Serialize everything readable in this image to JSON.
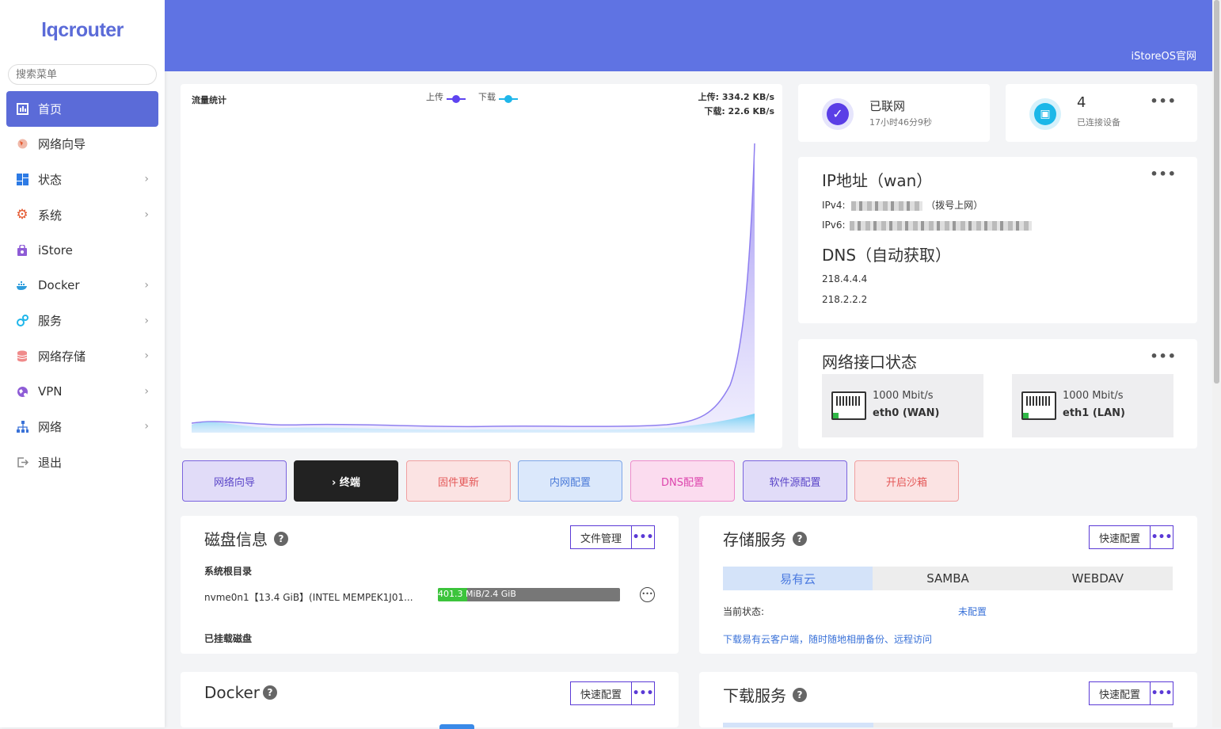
{
  "sidebar": {
    "logo": "lqcrouter",
    "search_placeholder": "搜索菜单",
    "items": [
      {
        "label": "首页",
        "icon": "dashboard-icon",
        "active": true
      },
      {
        "label": "网络向导",
        "icon": "globe-icon"
      },
      {
        "label": "状态",
        "icon": "grid-icon",
        "arrow": true
      },
      {
        "label": "系统",
        "icon": "gear-icon",
        "arrow": true
      },
      {
        "label": "iStore",
        "icon": "store-bag-icon"
      },
      {
        "label": "Docker",
        "icon": "docker-icon",
        "arrow": true
      },
      {
        "label": "服务",
        "icon": "services-icon",
        "arrow": true
      },
      {
        "label": "网络存储",
        "icon": "database-icon",
        "arrow": true
      },
      {
        "label": "VPN",
        "icon": "vpn-globe-icon",
        "arrow": true
      },
      {
        "label": "网络",
        "icon": "network-tree-icon",
        "arrow": true
      },
      {
        "label": "退出",
        "icon": "logout-icon"
      }
    ]
  },
  "header": {
    "link": "iStoreOS官网"
  },
  "traffic": {
    "title": "流量统计",
    "upload_legend": "上传",
    "download_legend": "下载",
    "upload_rate": "上传: 334.2 KB/s",
    "download_rate": "下载: 22.6 KB/s",
    "colors": {
      "upload": "#5e44f0",
      "download": "#1fb6ea"
    }
  },
  "connection": {
    "status": "已联网",
    "uptime": "17小时46分9秒"
  },
  "devices": {
    "count": "4",
    "label": "已连接设备"
  },
  "wan": {
    "title": "IP地址（wan）",
    "ipv4_label": "IPv4:",
    "ipv4_note": "（拨号上网）",
    "ipv6_label": "IPv6:",
    "dns_title": "DNS（自动获取）",
    "dns": [
      "218.4.4.4",
      "218.2.2.2"
    ]
  },
  "interfaces": {
    "title": "网络接口状态",
    "items": [
      {
        "speed": "1000 Mbit/s",
        "name": "eth0 (WAN)"
      },
      {
        "speed": "1000 Mbit/s",
        "name": "eth1 (LAN)"
      }
    ]
  },
  "quick_buttons": [
    {
      "label": "网络向导",
      "bg": "#e1dcf8",
      "border": "#7b64de",
      "color": "#5a45c8"
    },
    {
      "label": "› 终端",
      "bg": "#222222",
      "border": "#222222",
      "color": "#ffffff"
    },
    {
      "label": "固件更新",
      "bg": "#fbe3e3",
      "border": "#f0a0a0",
      "color": "#e45858"
    },
    {
      "label": "内网配置",
      "bg": "#dbe8fb",
      "border": "#7ea6e8",
      "color": "#4a7ad8"
    },
    {
      "label": "DNS配置",
      "bg": "#fbdcef",
      "border": "#ee8ccc",
      "color": "#dd45ad"
    },
    {
      "label": "软件源配置",
      "bg": "#e1dcf8",
      "border": "#7b64de",
      "color": "#5a45c8"
    },
    {
      "label": "开启沙箱",
      "bg": "#fbe3e3",
      "border": "#f0a0a0",
      "color": "#e45858"
    }
  ],
  "disk": {
    "title": "磁盘信息",
    "file_manager": "文件管理",
    "root_label": "系统根目录",
    "device": "nvme0n1【13.4 GiB】(INTEL MEMPEK1J01...",
    "usage_text": "401.3 MiB/2.4 GiB",
    "usage_fraction": 0.163,
    "mounted_label": "已挂载磁盘"
  },
  "storage": {
    "title": "存储服务",
    "quick_config": "快速配置",
    "tabs": [
      "易有云",
      "SAMBA",
      "WEBDAV"
    ],
    "status_label": "当前状态:",
    "status_value": "未配置",
    "link": "下载易有云客户端，随时随地相册备份、远程访问"
  },
  "docker": {
    "title": "Docker",
    "quick_config": "快速配置"
  },
  "download": {
    "title": "下载服务",
    "quick_config": "快速配置"
  }
}
